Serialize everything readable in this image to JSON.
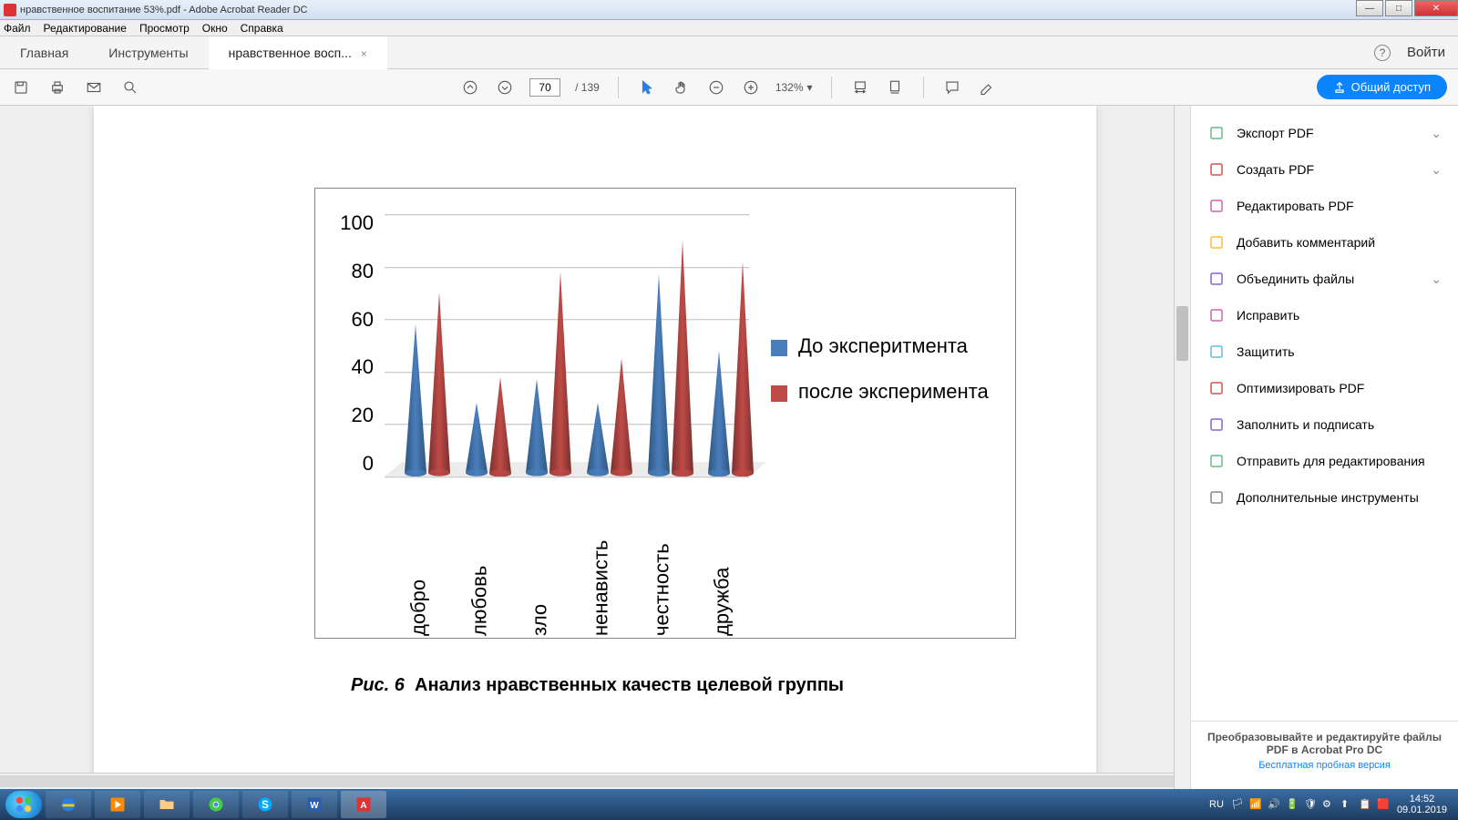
{
  "titlebar": {
    "caption": "нравственное воспитание 53%.pdf - Adobe Acrobat Reader DC"
  },
  "menubar": {
    "file": "Файл",
    "edit": "Редактирование",
    "view": "Просмотр",
    "window": "Окно",
    "help": "Справка"
  },
  "tabs": {
    "home": "Главная",
    "tools": "Инструменты",
    "doc": "нравственное восп...",
    "signin": "Войти"
  },
  "toolbar": {
    "page_current": "70",
    "page_sep": "/",
    "page_total": "139",
    "zoom": "132%",
    "share": "Общий доступ"
  },
  "rpanel": {
    "items": [
      {
        "label": "Экспорт PDF",
        "chev": true
      },
      {
        "label": "Создать PDF",
        "chev": true
      },
      {
        "label": "Редактировать PDF",
        "chev": false
      },
      {
        "label": "Добавить комментарий",
        "chev": false
      },
      {
        "label": "Объединить файлы",
        "chev": true
      },
      {
        "label": "Исправить",
        "chev": false
      },
      {
        "label": "Защитить",
        "chev": false
      },
      {
        "label": "Оптимизировать PDF",
        "chev": false
      },
      {
        "label": "Заполнить и подписать",
        "chev": false
      },
      {
        "label": "Отправить для редактирования",
        "chev": false
      },
      {
        "label": "Дополнительные инструменты",
        "chev": false
      }
    ],
    "footer_title": "Преобразовывайте и редактируйте файлы PDF в Acrobat Pro DC",
    "footer_link": "Бесплатная пробная версия"
  },
  "caption": {
    "fig": "Рис. 6",
    "text": "Анализ нравственных качеств целевой группы"
  },
  "legend": {
    "s1": "До эксперитмента",
    "s2": "после эксперимента"
  },
  "yticks": [
    "100",
    "80",
    "60",
    "40",
    "20",
    "0"
  ],
  "chart_data": {
    "type": "bar",
    "categories": [
      "добро",
      "любовь",
      "зло",
      "ненависть",
      "честность",
      "дружба"
    ],
    "series": [
      {
        "name": "До эксперитмента",
        "color": "#4A7EBB",
        "values": [
          58,
          28,
          37,
          28,
          77,
          48
        ]
      },
      {
        "name": "после эксперимента",
        "color": "#BE4B48",
        "values": [
          70,
          38,
          78,
          45,
          90,
          82
        ]
      }
    ],
    "ylim": [
      0,
      100
    ],
    "ylabel": "",
    "xlabel": "",
    "title": "Анализ нравственных качеств целевой группы"
  },
  "taskbar": {
    "lang": "RU",
    "time": "14:52",
    "date": "09.01.2019"
  }
}
